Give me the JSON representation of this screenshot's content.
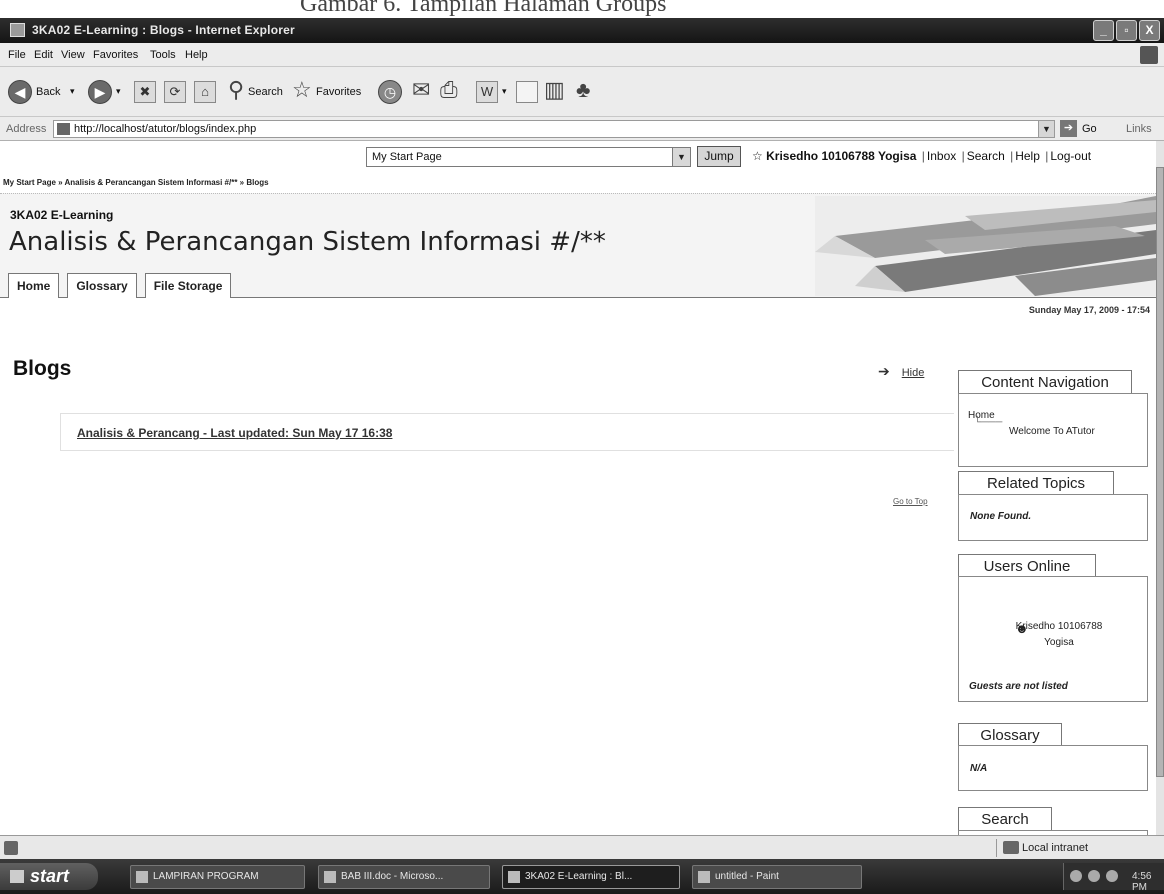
{
  "caption": "Gambar 6. Tampilan Halaman Groups",
  "window": {
    "title": "3KA02 E-Learning : Blogs - Internet Explorer",
    "controls": [
      "_",
      "▫",
      "X"
    ]
  },
  "menu": [
    "File",
    "Edit",
    "View",
    "Favorites",
    "Tools",
    "Help"
  ],
  "toolbar": {
    "back": "Back",
    "search": "Search",
    "favorites": "Favorites"
  },
  "address": {
    "label": "Address",
    "url": "http://localhost/atutor/blogs/index.php",
    "go": "Go",
    "links": "Links"
  },
  "page": {
    "jump_select_value": "My Start Page",
    "jump_button": "Jump",
    "user_name": "Krisedho 10106788 Yogisa",
    "user_links": [
      "Inbox",
      "Search",
      "Help",
      "Log-out"
    ],
    "breadcrumb": "My Start Page » Analisis & Perancangan Sistem Informasi #/** » Blogs",
    "course_code": "3KA02 E-Learning",
    "course_title": "Analisis & Perancangan Sistem Informasi #/**",
    "tabs": [
      "Home",
      "Glossary",
      "File Storage"
    ],
    "datetime": "Sunday May 17, 2009 - 17:54",
    "heading": "Blogs",
    "hide": "Hide",
    "blog_entry": "Analisis & Perancang - Last updated: Sun May 17 16:38",
    "go_to_top": "Go to Top"
  },
  "sidebar": {
    "content_navigation": {
      "title": "Content Navigation",
      "root": "Home",
      "child": "Welcome To ATutor"
    },
    "related_topics": {
      "title": "Related Topics",
      "text": "None Found."
    },
    "users_online": {
      "title": "Users Online",
      "user": "Krisedho 10106788 Yogisa",
      "note": "Guests are not listed"
    },
    "glossary": {
      "title": "Glossary",
      "text": "N/A"
    },
    "search": {
      "title": "Search"
    }
  },
  "statusbar": {
    "zone": "Local intranet"
  },
  "taskbar": {
    "start": "start",
    "tasks": [
      "LAMPIRAN PROGRAM",
      "BAB III.doc - Microso...",
      "3KA02 E-Learning : Bl...",
      "untitled - Paint"
    ],
    "clock": "4:56 PM"
  }
}
